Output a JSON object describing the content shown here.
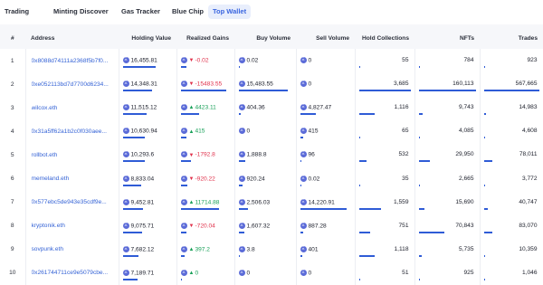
{
  "tabs": [
    {
      "label": "Trading"
    },
    {
      "label": "Minting"
    },
    {
      "label": "Discover"
    },
    {
      "label": "Gas Tracker"
    },
    {
      "label": "Blue Chip"
    },
    {
      "label": "Top Wallet",
      "active": true
    }
  ],
  "columns": {
    "index": "#",
    "address": "Address",
    "holding_value": "Holding Value",
    "realized_gains": "Realized Gains",
    "buy_volume": "Buy Volume",
    "sell_volume": "Sell Volume",
    "hold_collections": "Hold Collections",
    "nfts": "NFTs",
    "trades": "Trades"
  },
  "colors": {
    "accent": "#3b66e0",
    "negative": "#e0314b",
    "positive": "#18a058",
    "bar": "#2f5cd6"
  },
  "currency_icon": "eth-icon",
  "rows": [
    {
      "index": "1",
      "address": "0x8088d74111a2368f5b7f0...",
      "holding_value": "16,455.81",
      "gain_dir": "down",
      "gain": "-0.02",
      "buy_volume": "0.02",
      "sell_volume": "0",
      "hold_collections": "55",
      "nfts": "784",
      "trades": "923",
      "bars": {
        "holding": 0.65,
        "gain": 0.1,
        "buy": 0.02,
        "sell": 0,
        "hold": 0.02,
        "nfts": 0.01,
        "trades": 0.02
      }
    },
    {
      "index": "2",
      "address": "0xe052113bd7d7700d6234...",
      "holding_value": "14,348.31",
      "gain_dir": "down",
      "gain": "-15483.55",
      "buy_volume": "15,483.55",
      "sell_volume": "0",
      "hold_collections": "3,685",
      "nfts": "160,113",
      "trades": "567,665",
      "bars": {
        "holding": 0.58,
        "gain": 0.9,
        "buy": 0.9,
        "sell": 0,
        "hold": 0.98,
        "nfts": 0.98,
        "trades": 0.98
      }
    },
    {
      "index": "3",
      "address": "wilcox.eth",
      "holding_value": "11,515.12",
      "gain_dir": "up",
      "gain": "4423.11",
      "buy_volume": "404.36",
      "sell_volume": "4,827.47",
      "hold_collections": "1,116",
      "nfts": "9,743",
      "trades": "14,983",
      "bars": {
        "holding": 0.47,
        "gain": 0.35,
        "buy": 0.03,
        "sell": 0.3,
        "hold": 0.3,
        "nfts": 0.06,
        "trades": 0.03
      }
    },
    {
      "index": "4",
      "address": "0x31a5ff62a1b2c0f030aee...",
      "holding_value": "10,630.94",
      "gain_dir": "up",
      "gain": "415",
      "buy_volume": "0",
      "sell_volume": "415",
      "hold_collections": "65",
      "nfts": "4,085",
      "trades": "4,608",
      "bars": {
        "holding": 0.43,
        "gain": 0.1,
        "buy": 0,
        "sell": 0.05,
        "hold": 0.02,
        "nfts": 0.02,
        "trades": 0.01
      }
    },
    {
      "index": "5",
      "address": "rollbot.eth",
      "holding_value": "10,293.6",
      "gain_dir": "down",
      "gain": "-1792.8",
      "buy_volume": "1,888.8",
      "sell_volume": "96",
      "hold_collections": "532",
      "nfts": "29,950",
      "trades": "78,011",
      "bars": {
        "holding": 0.42,
        "gain": 0.2,
        "buy": 0.12,
        "sell": 0.02,
        "hold": 0.14,
        "nfts": 0.19,
        "trades": 0.14
      }
    },
    {
      "index": "6",
      "address": "memeland.eth",
      "holding_value": "8,833.04",
      "gain_dir": "down",
      "gain": "-920.22",
      "buy_volume": "920.24",
      "sell_volume": "0.02",
      "hold_collections": "35",
      "nfts": "2,665",
      "trades": "3,772",
      "bars": {
        "holding": 0.36,
        "gain": 0.12,
        "buy": 0.06,
        "sell": 0.01,
        "hold": 0.01,
        "nfts": 0.02,
        "trades": 0.01
      }
    },
    {
      "index": "7",
      "address": "0x577ebc5de943e35cdf9e...",
      "holding_value": "9,452.81",
      "gain_dir": "up",
      "gain": "11714.88",
      "buy_volume": "2,506.03",
      "sell_volume": "14,220.91",
      "hold_collections": "1,559",
      "nfts": "15,690",
      "trades": "40,747",
      "bars": {
        "holding": 0.39,
        "gain": 0.75,
        "buy": 0.16,
        "sell": 0.9,
        "hold": 0.42,
        "nfts": 0.1,
        "trades": 0.07
      }
    },
    {
      "index": "8",
      "address": "kryptonik.eth",
      "holding_value": "9,075.71",
      "gain_dir": "down",
      "gain": "-720.04",
      "buy_volume": "1,607.32",
      "sell_volume": "887.28",
      "hold_collections": "751",
      "nfts": "70,843",
      "trades": "83,070",
      "bars": {
        "holding": 0.37,
        "gain": 0.1,
        "buy": 0.1,
        "sell": 0.06,
        "hold": 0.2,
        "nfts": 0.44,
        "trades": 0.15
      }
    },
    {
      "index": "9",
      "address": "sovpunk.eth",
      "holding_value": "7,682.12",
      "gain_dir": "up",
      "gain": "397.2",
      "buy_volume": "3.8",
      "sell_volume": "401",
      "hold_collections": "1,118",
      "nfts": "5,735",
      "trades": "10,359",
      "bars": {
        "holding": 0.31,
        "gain": 0.08,
        "buy": 0.01,
        "sell": 0.03,
        "hold": 0.3,
        "nfts": 0.04,
        "trades": 0.02
      }
    },
    {
      "index": "10",
      "address": "0x261744711ce9e5079cbe...",
      "holding_value": "7,189.71",
      "gain_dir": "up",
      "gain": "0",
      "buy_volume": "0",
      "sell_volume": "0",
      "hold_collections": "51",
      "nfts": "925",
      "trades": "1,046",
      "bars": {
        "holding": 0.29,
        "gain": 0.02,
        "buy": 0,
        "sell": 0,
        "hold": 0.01,
        "nfts": 0.01,
        "trades": 0.01
      }
    }
  ]
}
